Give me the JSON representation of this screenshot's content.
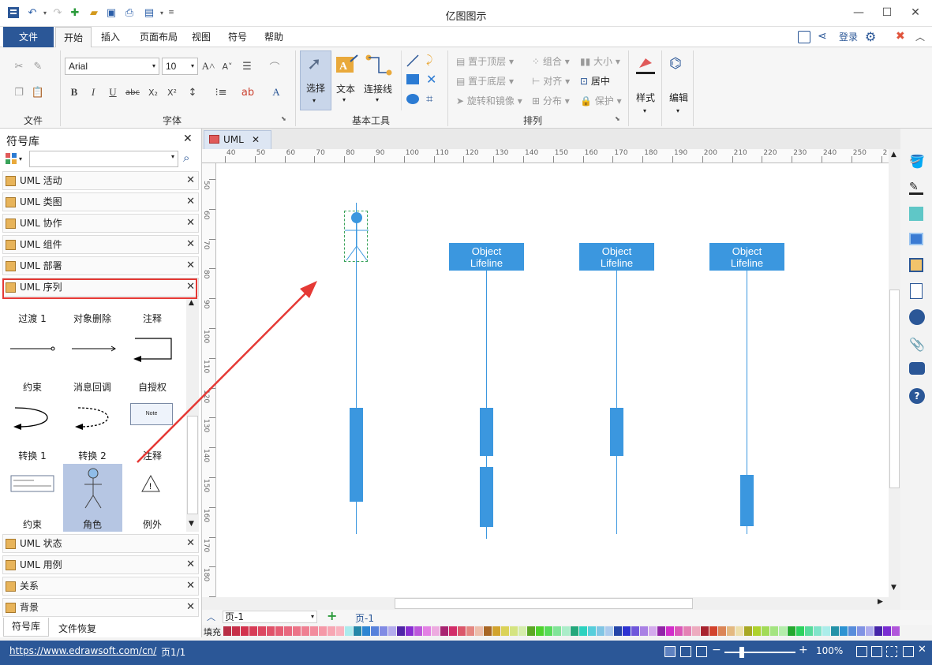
{
  "app": {
    "title": "亿图图示"
  },
  "menu": {
    "tabs": [
      "文件",
      "开始",
      "插入",
      "页面布局",
      "视图",
      "符号",
      "帮助"
    ],
    "login": "登录"
  },
  "ribbon": {
    "groups": {
      "file": "文件",
      "font": "字体",
      "basic_tools": "基本工具",
      "arrange": "排列"
    },
    "font_name": "Arial",
    "font_size": "10",
    "tools": {
      "select": "选择",
      "text": "文本",
      "connector": "连接线"
    },
    "arrange": {
      "bring_front": "置于顶层",
      "send_back": "置于底层",
      "rotate_mirror": "旋转和镜像",
      "group": "组合",
      "align": "对齐",
      "distribute": "分布",
      "size": "大小",
      "center": "居中",
      "protect": "保护"
    },
    "style": "样式",
    "edit": "编辑"
  },
  "library": {
    "title": "符号库",
    "items_top": [
      "UML 活动",
      "UML 类图",
      "UML 协作",
      "UML 组件",
      "UML 部署",
      "UML 序列"
    ],
    "items_bottom": [
      "UML 状态",
      "UML 用例",
      "关系",
      "背景"
    ],
    "shape_labels": [
      "过渡 1",
      "对象删除",
      "注释",
      "约束",
      "消息回调",
      "自授权",
      "转换 1",
      "转换 2",
      "注释",
      "约束",
      "角色",
      "例外"
    ],
    "note_text": "Note",
    "tabs": [
      "符号库",
      "文件恢复"
    ]
  },
  "document": {
    "tab": "UML",
    "lifeline_label": "Object\nLifeline"
  },
  "ruler": {
    "h": [
      "40",
      "50",
      "60",
      "70",
      "80",
      "90",
      "100",
      "110",
      "120",
      "130",
      "140",
      "150",
      "160",
      "170",
      "180",
      "190",
      "200",
      "210",
      "220",
      "230",
      "240",
      "250",
      "2"
    ],
    "v": [
      "50",
      "60",
      "70",
      "80",
      "90",
      "100",
      "110",
      "120",
      "130",
      "140",
      "150",
      "160",
      "170",
      "180",
      "190"
    ]
  },
  "pagebar": {
    "page_select": "页-1",
    "page_tab": "页-1",
    "fill": "填充"
  },
  "status": {
    "url": "https://www.edrawsoft.com/cn/",
    "page": "页1/1",
    "zoom": "100%"
  },
  "colors": {
    "accent": "#2b5797",
    "shape": "#3b97df",
    "highlight": "#e53935"
  }
}
